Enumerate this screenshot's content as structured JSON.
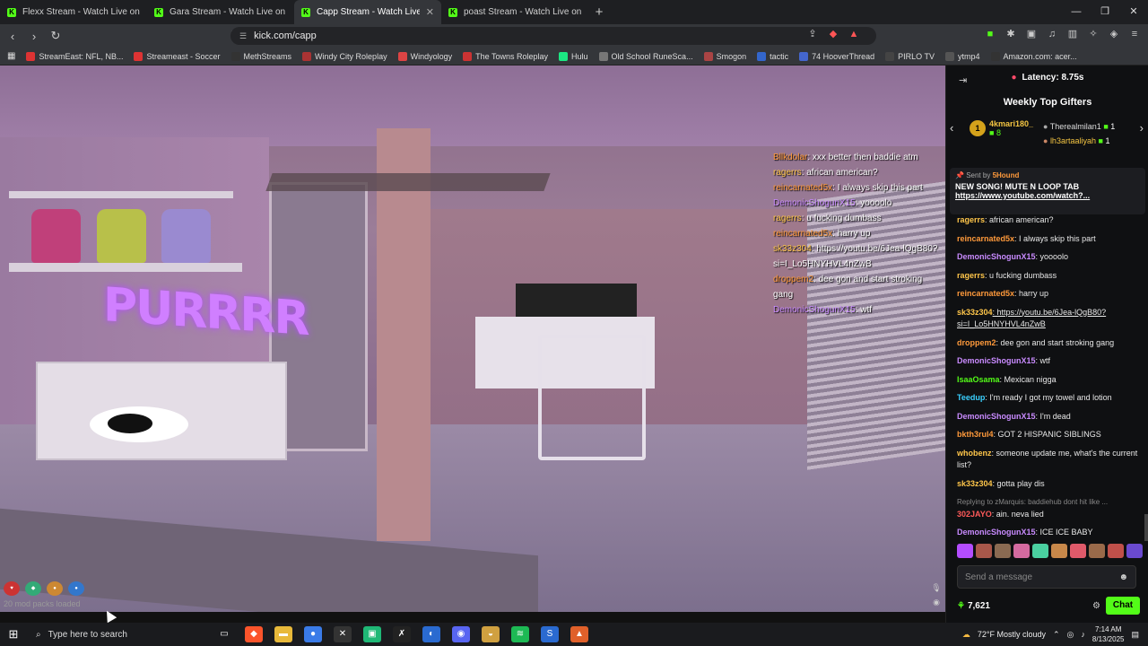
{
  "tabs": [
    {
      "title": "Flexx Stream - Watch Live on Kick"
    },
    {
      "title": "Gara Stream - Watch Live on Kick"
    },
    {
      "title": "Capp Stream - Watch Live on"
    },
    {
      "title": "poast Stream - Watch Live on Kick"
    }
  ],
  "url": "kick.com/capp",
  "bookmarks": [
    {
      "label": "StreamEast: NFL, NB...",
      "color": "#d33"
    },
    {
      "label": "Streameast - Soccer",
      "color": "#d33"
    },
    {
      "label": "MethStreams",
      "color": "#333"
    },
    {
      "label": "Windy City Roleplay",
      "color": "#a33"
    },
    {
      "label": "Windyology",
      "color": "#d44"
    },
    {
      "label": "The Towns Roleplay",
      "color": "#c33"
    },
    {
      "label": "Hulu",
      "color": "#1ce783"
    },
    {
      "label": "Old School RuneSca...",
      "color": "#777"
    },
    {
      "label": "Smogon",
      "color": "#a44"
    },
    {
      "label": "tactic",
      "color": "#36c"
    },
    {
      "label": "74 HooverThread",
      "color": "#46c"
    },
    {
      "label": "PIRLO TV",
      "color": "#444"
    },
    {
      "label": "ytmp4",
      "color": "#555"
    },
    {
      "label": "Amazon.com: acer...",
      "color": "#333"
    }
  ],
  "video": {
    "neon_sign": "PURRRR",
    "hud_text": "20 mod packs loaded",
    "overlay_chat": [
      {
        "user": "Bllkdolar",
        "text": ": xxx better then baddie atm",
        "cls": "u2"
      },
      {
        "user": "ragerrs",
        "text": ": african american?",
        "cls": "u5"
      },
      {
        "user": "reincarnated5x",
        "text": ": I always skip this part",
        "cls": "u2"
      },
      {
        "user": "DemonicShogunX15",
        "text": ": yoooolo",
        "cls": "u3"
      },
      {
        "user": "ragerrs",
        "text": ": u fucking dumbass",
        "cls": "u5"
      },
      {
        "user": "reincarnated5x",
        "text": ": harry up",
        "cls": "u2"
      },
      {
        "user": "sk33z304",
        "text": ": https://youtu.be/6Jea-lQgB80?si=I_Lo5HNYHVL4nZwB",
        "cls": "u5"
      },
      {
        "user": "droppem2",
        "text": ": dee gon and start stroking gang",
        "cls": "u2"
      },
      {
        "user": "DemonicShogunX15",
        "text": ": wtf",
        "cls": "u3"
      }
    ]
  },
  "sidebar": {
    "latency": "Latency: 8.75s",
    "gifters_title": "Weekly Top Gifters",
    "gifter1": {
      "rank": "1",
      "name": "4kmari180_",
      "count": "8"
    },
    "gifter2": {
      "name": "Therealmilan1",
      "count": "1"
    },
    "gifter3": {
      "name": "lh3artaaliyah",
      "count": "1"
    },
    "pinned": {
      "sent_by": "Sent by",
      "sender": "5Hound",
      "title": "NEW SONG! MUTE N LOOP TAB",
      "link": "https://www.youtube.com/watch?..."
    },
    "messages": [
      {
        "user": "ragerrs",
        "text": ": african american?",
        "color": "c-yellow"
      },
      {
        "user": "reincarnated5x",
        "text": ": I always skip this part",
        "color": "c-orange"
      },
      {
        "user": "DemonicShogunX15",
        "text": ": yoooolo",
        "color": "c-purple"
      },
      {
        "user": "ragerrs",
        "text": ": u fucking dumbass",
        "color": "c-yellow"
      },
      {
        "user": "reincarnated5x",
        "text": ": harry up",
        "color": "c-orange"
      },
      {
        "user": "sk33z304",
        "text": ": https://youtu.be/6Jea-lQgB80?si=I_Lo5HNYHVL4nZwB",
        "color": "c-yellow",
        "link": true
      },
      {
        "user": "droppem2",
        "text": ": dee gon and start stroking gang",
        "color": "c-orange"
      },
      {
        "user": "DemonicShogunX15",
        "text": ": wtf",
        "color": "c-purple"
      },
      {
        "user": "IsaaOsama",
        "text": ": Mexican nigga",
        "color": "c-green"
      },
      {
        "user": "Teedup",
        "text": ": I'm ready I got my towel and lotion",
        "color": "c-teal"
      },
      {
        "user": "DemonicShogunX15",
        "text": ": I'm dead",
        "color": "c-purple"
      },
      {
        "user": "bkth3rul4",
        "text": ": GOT 2 HISPANIC SIBLINGS",
        "color": "c-orange"
      },
      {
        "user": "whobenz",
        "text": ": someone update me, what's the current list?",
        "color": "c-yellow"
      },
      {
        "user": "sk33z304",
        "text": ": gotta play dis",
        "color": "c-yellow"
      }
    ],
    "reply_note": "Replying to zMarquis: baddiehub dont hit like ...",
    "reply_msg": {
      "user": "302JAYO",
      "text": ": ain. neva lied"
    },
    "last_msg": {
      "user": "DemonicShogunX15",
      "text": ": ICE ICE BABY"
    },
    "send_placeholder": "Send a message",
    "points": "7,621",
    "chat_button": "Chat"
  },
  "taskbar": {
    "search_placeholder": "Type here to search",
    "weather": "72°F  Mostly cloudy",
    "time": "7:14 AM",
    "date": "8/13/2025"
  }
}
